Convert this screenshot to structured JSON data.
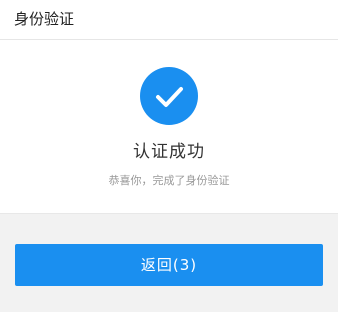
{
  "header": {
    "title": "身份验证"
  },
  "result": {
    "icon": "check-circle-icon",
    "title": "认证成功",
    "subtitle": "恭喜你，完成了身份验证"
  },
  "actions": {
    "back_label": "返回(3)"
  },
  "colors": {
    "accent": "#1a8ff0",
    "page_background": "#f2f2f2",
    "card_background": "#ffffff"
  }
}
